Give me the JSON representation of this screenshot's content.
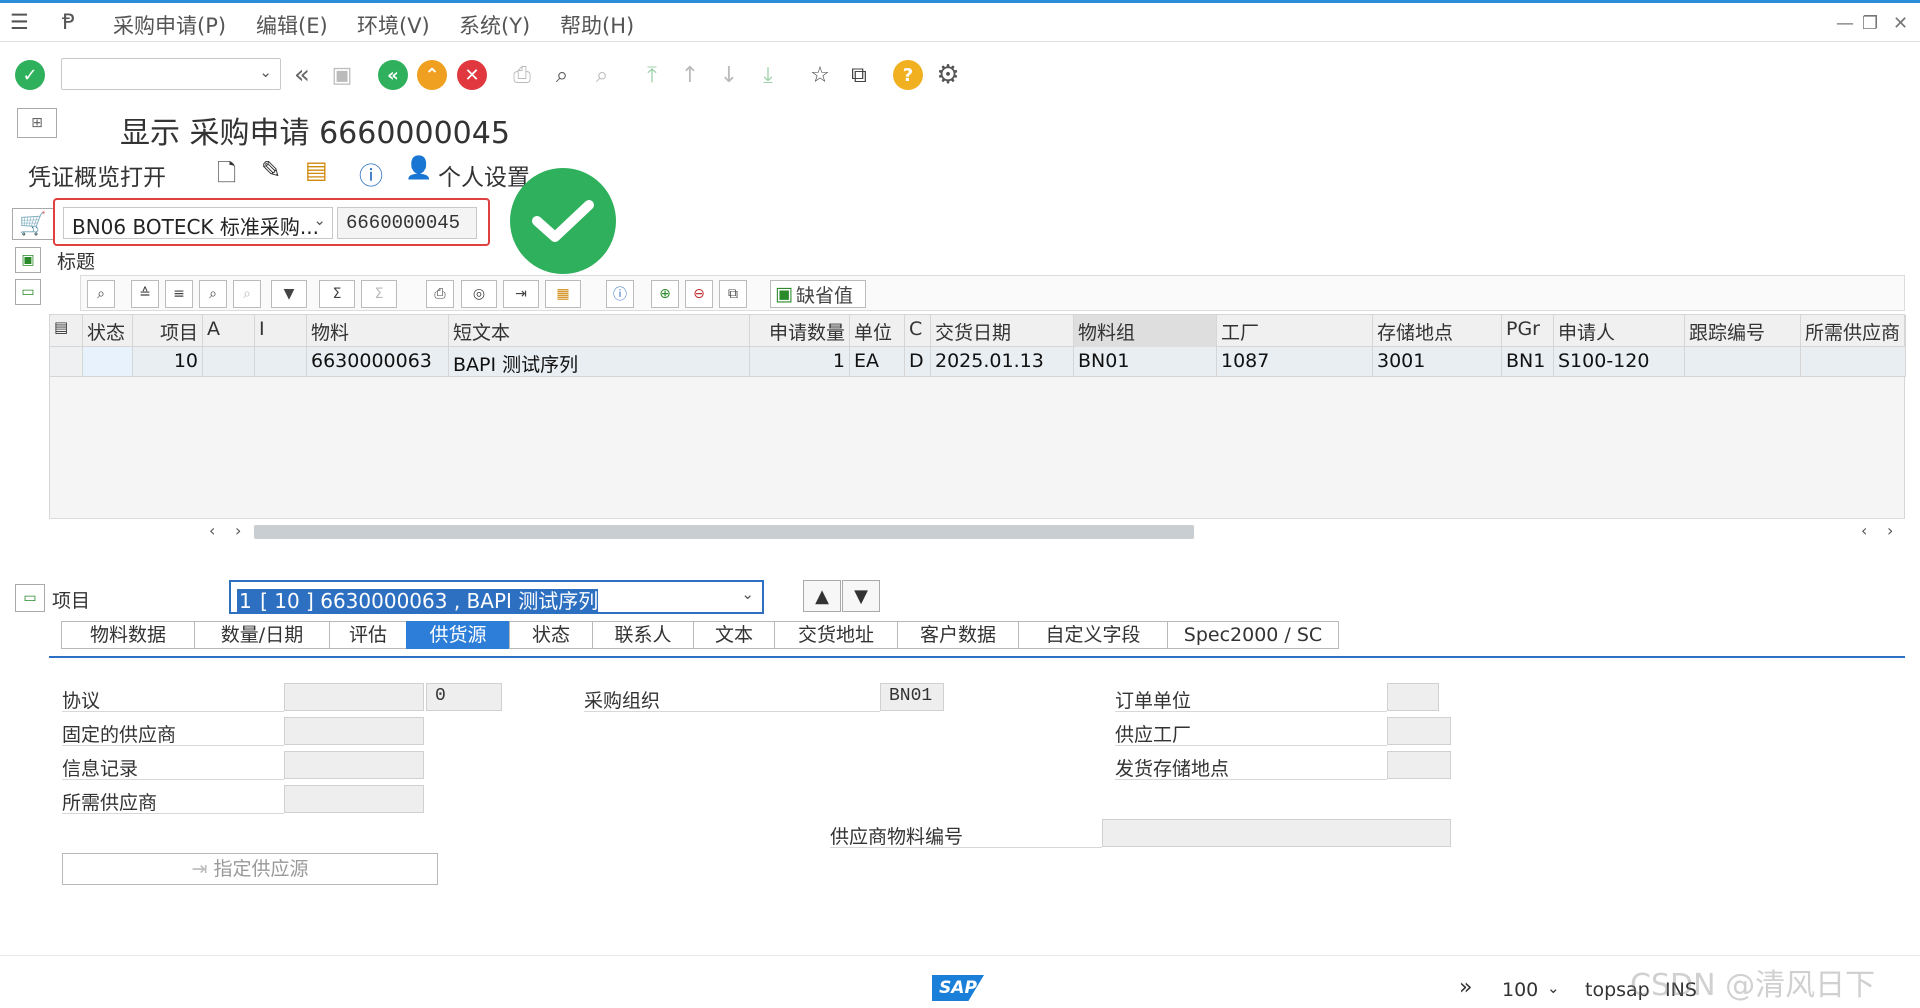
{
  "menu": {
    "items": [
      "采购申请(P)",
      "编辑(E)",
      "环境(V)",
      "系统(Y)",
      "帮助(H)"
    ]
  },
  "title": {
    "text": "显示 采购申请 6660000045"
  },
  "app_toolbar": {
    "overview_label": "凭证概览打开",
    "personal_settings_label": "个人设置"
  },
  "header": {
    "doc_type": "BN06 BOTECK 标准采购...",
    "doc_number": "6660000045",
    "section_label": "标题"
  },
  "alv_toolbar": {
    "default_values_label": "缺省值"
  },
  "grid": {
    "columns": [
      "状态",
      "项目",
      "A",
      "I",
      "物料",
      "短文本",
      "申请数量",
      "单位",
      "C",
      "交货日期",
      "物料组",
      "工厂",
      "存储地点",
      "PGr",
      "申请人",
      "跟踪编号",
      "所需供应商"
    ],
    "rows": [
      [
        "",
        "10",
        "",
        "",
        "6630000063",
        "BAPI 测试序列",
        "1",
        "EA",
        "D",
        "2025.01.13",
        "BN01",
        "1087",
        "3001",
        "BN1",
        "S100-120",
        "",
        ""
      ]
    ]
  },
  "item": {
    "label": "项目",
    "selected_prefix": "1",
    "selected_rest": " [ 10 ] 6630000063 , BAPI 测试序列"
  },
  "tabs": [
    "物料数据",
    "数量/日期",
    "评估",
    "供货源",
    "状态",
    "联系人",
    "文本",
    "交货地址",
    "客户数据",
    "自定义字段",
    "Spec2000 / SC"
  ],
  "active_tab": "供货源",
  "form": {
    "agreement_label": "协议",
    "agreement_item": "0",
    "fixed_vendor_label": "固定的供应商",
    "info_record_label": "信息记录",
    "desired_vendor_label": "所需供应商",
    "purch_org_label": "采购组织",
    "purch_org_value": "BN01",
    "order_unit_label": "订单单位",
    "supplying_plant_label": "供应工厂",
    "issuing_sloc_label": "发货存储地点",
    "vendor_material_label": "供应商物料编号",
    "assign_source_label": "指定供应源"
  },
  "status_bar": {
    "zoom": "100",
    "system": "topsap",
    "mode": "INS",
    "watermark": "CSDN @清风日下"
  },
  "colors": {
    "accent": "#2d7ed8",
    "ok_green": "#2fb05c",
    "cancel_red": "#e0383e",
    "warn_orange": "#f0a020"
  }
}
